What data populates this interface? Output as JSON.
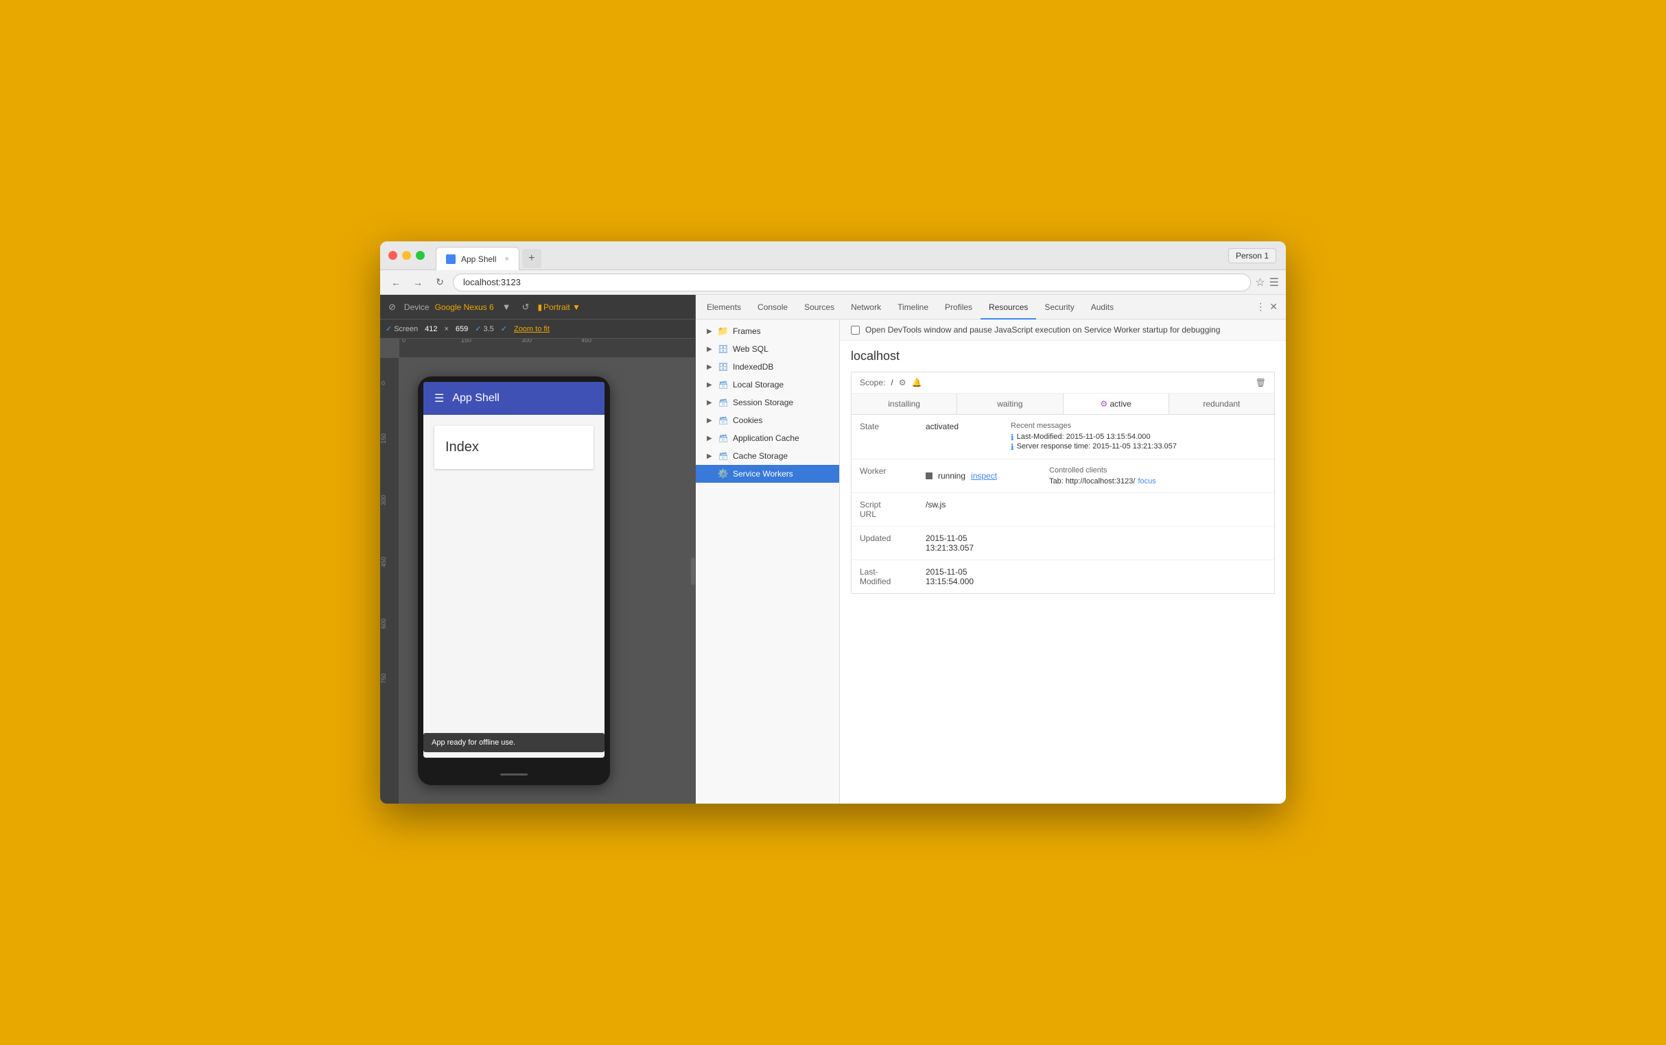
{
  "browser": {
    "tab_title": "App Shell",
    "tab_close": "×",
    "address": "localhost:3123",
    "profile": "Person 1"
  },
  "devtools": {
    "tabs": [
      "Elements",
      "Console",
      "Sources",
      "Network",
      "Timeline",
      "Profiles",
      "Resources",
      "Security",
      "Audits"
    ],
    "active_tab": "Resources",
    "debug_checkbox_label": "Open DevTools window and pause JavaScript execution on Service Worker startup for debugging"
  },
  "device_toolbar": {
    "device_label": "Device",
    "device_name": "Google Nexus 6",
    "orientation": "Portrait ▼",
    "screen_label": "Screen",
    "width": "412",
    "x_sep": "×",
    "height": "659",
    "dpr": "3.5",
    "zoom_label": "Zoom to fit"
  },
  "ruler": {
    "top_marks": [
      "0",
      "150",
      "300",
      "450"
    ],
    "left_marks": [
      "0",
      "150",
      "300",
      "450",
      "600",
      "750"
    ]
  },
  "app": {
    "header_menu": "☰",
    "title": "App Shell",
    "index_title": "Index",
    "toast": "App ready for offline use."
  },
  "resources_tree": [
    {
      "id": "frames",
      "label": "Frames",
      "type": "folder",
      "expanded": true
    },
    {
      "id": "web-sql",
      "label": "Web SQL",
      "type": "db"
    },
    {
      "id": "indexeddb",
      "label": "IndexedDB",
      "type": "db"
    },
    {
      "id": "local-storage",
      "label": "Local Storage",
      "type": "storage"
    },
    {
      "id": "session-storage",
      "label": "Session Storage",
      "type": "storage"
    },
    {
      "id": "cookies",
      "label": "Cookies",
      "type": "storage"
    },
    {
      "id": "application-cache",
      "label": "Application Cache",
      "type": "storage"
    },
    {
      "id": "cache-storage",
      "label": "Cache Storage",
      "type": "storage"
    },
    {
      "id": "service-workers",
      "label": "Service Workers",
      "type": "sw",
      "selected": true
    }
  ],
  "service_worker": {
    "origin": "localhost",
    "scope_label": "Scope:",
    "scope_value": "/",
    "status_tabs": [
      "installing",
      "waiting",
      "active",
      "redundant"
    ],
    "active_status": "active",
    "state_label": "State",
    "state_value": "activated",
    "worker_label": "Worker",
    "worker_status": "running",
    "worker_action": "inspect",
    "script_url_label": "Script URL",
    "script_url_value": "/sw.js",
    "updated_label": "Updated",
    "updated_value": "2015-11-05\n13:21:33.057",
    "last_modified_label": "Last-\nModified",
    "last_modified_value": "2015-11-05\n13:15:54.000",
    "recent_messages_label": "Recent messages",
    "messages": [
      "Last-Modified: 2015-11-05 13:15:54.000",
      "Server response time: 2015-11-05 13:21:33.057"
    ],
    "controlled_clients_label": "Controlled clients",
    "controlled_client_prefix": "Tab: http://localhost:3123/",
    "controlled_client_link": "focus"
  }
}
